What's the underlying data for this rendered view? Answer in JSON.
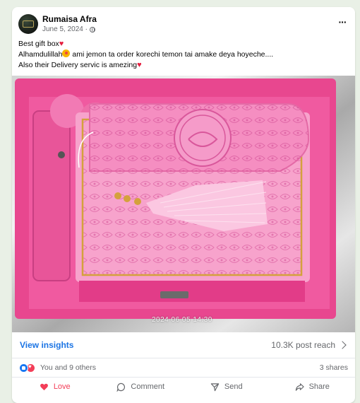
{
  "post": {
    "author": "Rumaisa Afra",
    "date": "June 5, 2024 ·",
    "text_lines": [
      "Best gift box",
      "Alhamdulillah",
      " ami jemon ta order korechi temon tai amake deya hoyeche....",
      "Also their Delivery servic is amezing"
    ],
    "more_label": "···",
    "photo_timestamp": "2024 06 05  14:30"
  },
  "insights": {
    "view_label": "View insights",
    "reach": "10.3K post reach"
  },
  "reactions": {
    "summary": "You and 9 others",
    "shares": "3 shares"
  },
  "actions": {
    "love": "Love",
    "comment": "Comment",
    "send": "Send",
    "share": "Share"
  },
  "colors": {
    "accent_blue": "#1b74e4",
    "love_red": "#f33e58",
    "muted_text": "#65676b"
  }
}
